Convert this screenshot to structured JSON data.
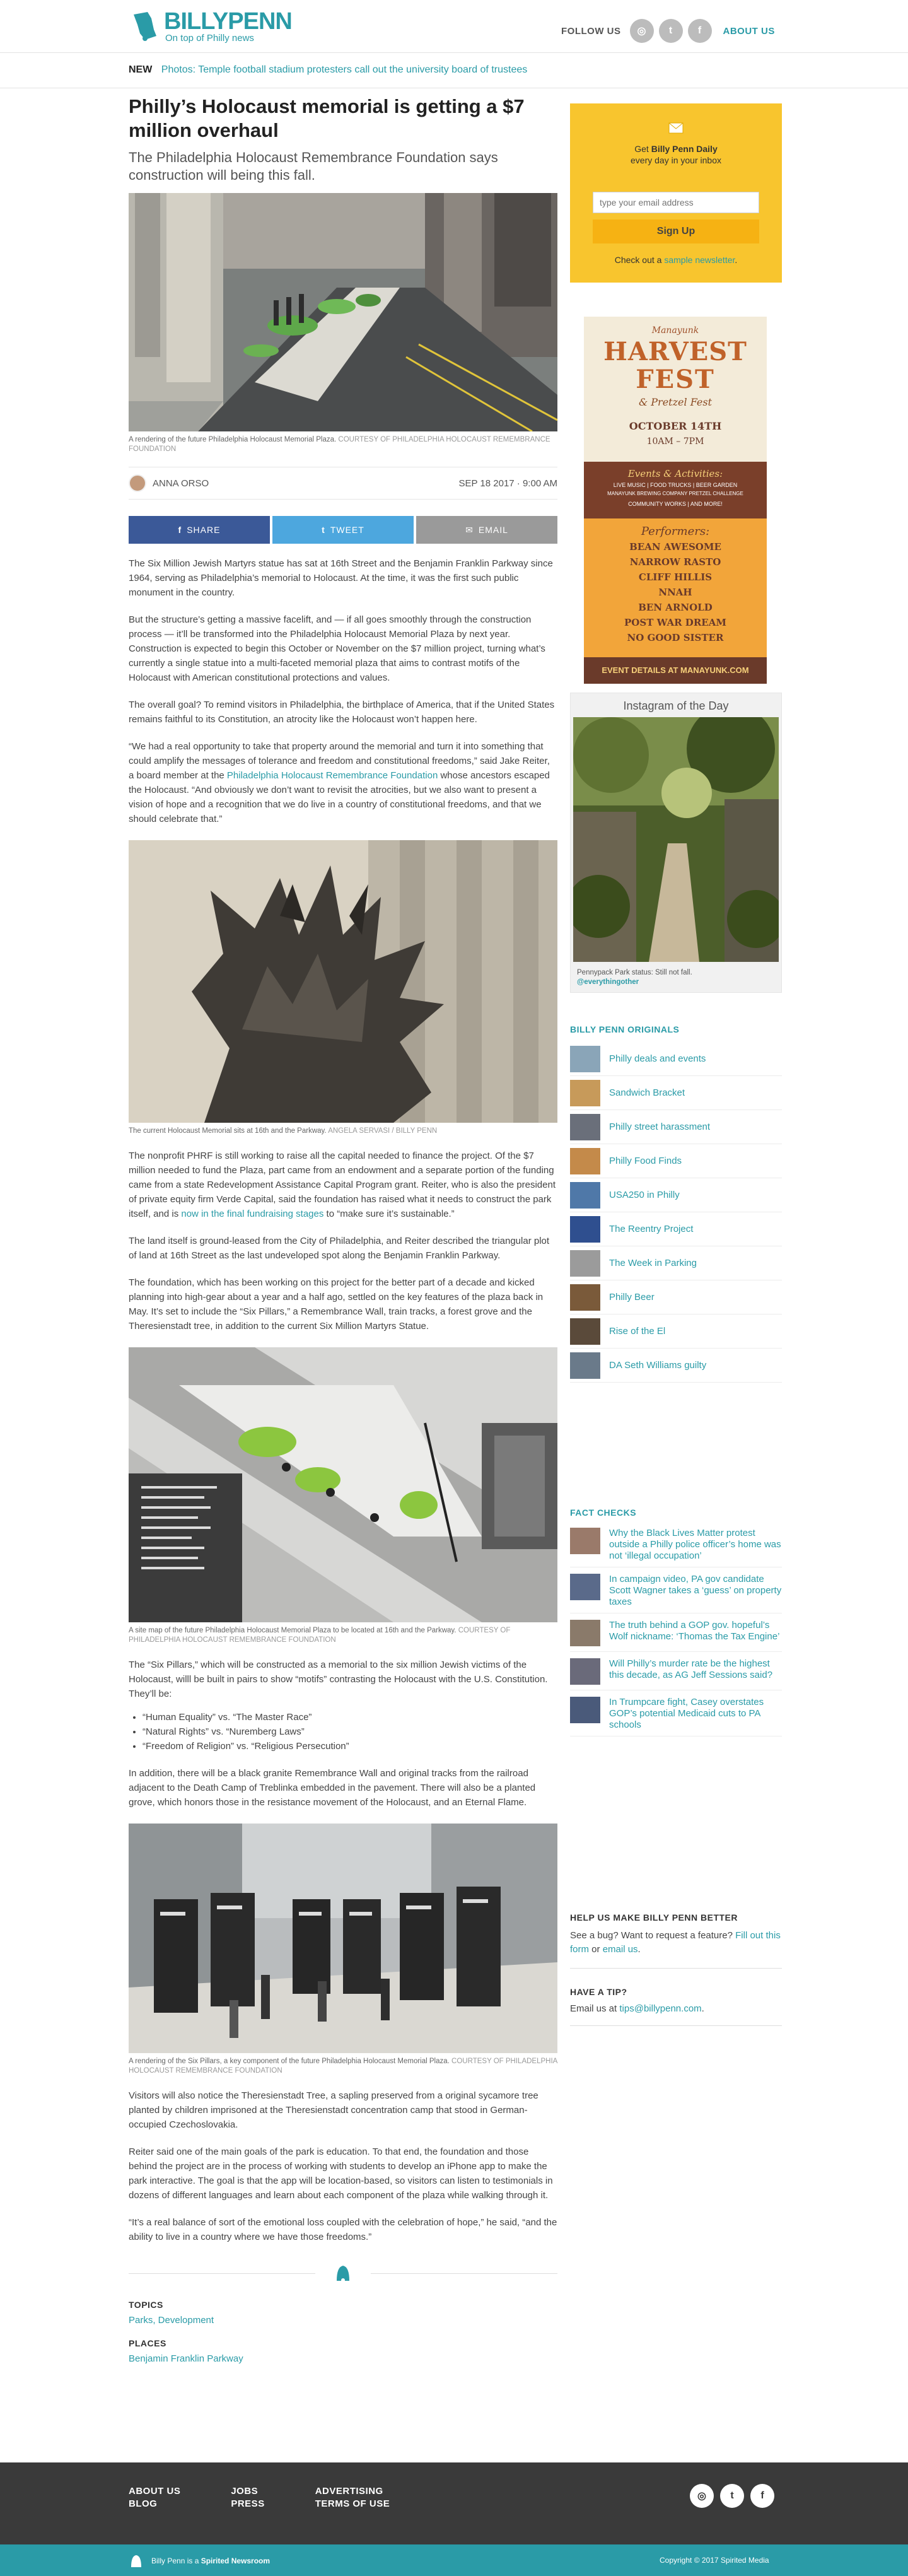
{
  "header": {
    "logo_title": "BILLYPENN",
    "logo_tagline": "On top of Philly news",
    "follow_label": "FOLLOW US",
    "about_label": "ABOUT US"
  },
  "news_bar": {
    "label": "NEW",
    "headline": "Photos: Temple football stadium protesters call out the university board of trustees"
  },
  "article": {
    "title": "Philly’s Holocaust memorial is getting a $7 million overhaul",
    "subtitle": "The Philadelphia Holocaust Remembrance Foundation says construction will being this fall.",
    "hero_caption": "A rendering of the future Philadelphia Holocaust Memorial Plaza.",
    "hero_credit": "COURTESY OF PHILADELPHIA HOLOCAUST REMEMBRANCE FOUNDATION",
    "author": "ANNA ORSO",
    "date": "SEP 18 2017 · 9:00 AM",
    "share": {
      "facebook": "SHARE",
      "twitter": "TWEET",
      "email": "EMAIL"
    },
    "p1": "The Six Million Jewish Martyrs statue has sat at 16th Street and the Benjamin Franklin Parkway since 1964, serving as Philadelphia’s memorial to Holocaust. At the time, it was the first such public monument in the country.",
    "p2": "But the structure’s getting a massive facelift, and — if all goes smoothly through the construction process — it’ll be transformed into the Philadelphia Holocaust Memorial Plaza by next year. Construction is expected to begin this October or November on the $7 million project, turning what’s currently a single statue into a multi-faceted memorial plaza that aims to contrast motifs of the Holocaust with American constitutional protections and values.",
    "p3": "The overall goal? To remind visitors in Philadelphia, the birthplace of America, that if the United States remains faithful to its Constitution, an atrocity like the Holocaust won’t happen here.",
    "p4a": "“We had a real opportunity to take that property around the memorial and turn it into something that could amplify the messages of tolerance and freedom and constitutional freedoms,” said Jake Reiter, a board member at the ",
    "p4_link": "Philadelphia Holocaust Remembrance Foundation",
    "p4b": " whose ancestors escaped the Holocaust. “And obviously we don’t want to revisit the atrocities, but we also want to present a vision of hope and a recognition that we do live in a country of constitutional freedoms, and that we should celebrate that.”",
    "statue_caption": "The current Holocaust Memorial sits at 16th and the Parkway.",
    "statue_credit": "ANGELA SERVASI / BILLY PENN",
    "p5a": "The nonprofit PHRF is still working to raise all the capital needed to finance the project. Of the $7 million needed to fund the Plaza, part came from an endowment and a separate portion of the funding came from a state Redevelopment Assistance Capital Program grant. Reiter, who is also the president of private equity firm Verde Capital, said the foundation has raised what it needs to construct the park itself, and is ",
    "p5_link": "now in the final fundraising stages",
    "p5b": " to “make sure it’s sustainable.”",
    "p6": "The land itself is ground-leased from the City of Philadelphia, and Reiter described the triangular plot of land at 16th Street as the last undeveloped spot along the Benjamin Franklin Parkway.",
    "p7": "The foundation, which has been working on this project for the better part of a decade and kicked planning into high-gear about a year and a half ago, settled on the key features of the plaza back in May. It’s set to include the “Six Pillars,” a Remembrance Wall, train tracks, a forest grove and the Theresienstadt tree, in addition to the current Six Million Martyrs Statue.",
    "map_caption": "A site map of the future Philadelphia Holocaust Memorial Plaza to be located at 16th and the Parkway.",
    "map_credit": "COURTESY OF PHILADELPHIA HOLOCAUST REMEMBRANCE FOUNDATION",
    "p8": "The “Six Pillars,” which will be constructed as a memorial to the six million Jewish victims of the Holocaust, willl be built in pairs to show “motifs” contrasting the Holocaust with the U.S. Constitution. They’ll be:",
    "bullets": [
      "“Human Equality” vs. “The Master Race”",
      "“Natural Rights” vs. “Nuremberg Laws”",
      "“Freedom of Religion” vs. “Religious Persecution”"
    ],
    "p9": "In addition, there will be a black granite Remembrance Wall and original tracks from the railroad adjacent to the Death Camp of Treblinka embedded in the pavement. There will also be a planted grove, which honors those in the resistance movement of the Holocaust, and an Eternal Flame.",
    "pillars_caption": "A rendering of the Six Pillars, a key component of the future Philadelphia Holocaust Memorial Plaza.",
    "pillars_credit": "COURTESY OF PHILADELPHIA HOLOCAUST REMEMBRANCE FOUNDATION",
    "p10": "Visitors will also notice the Theresienstadt Tree, a sapling preserved from a original sycamore tree planted by children imprisoned at the Theresienstadt concentration camp that stood in German-occupied Czechoslovakia.",
    "p11": "Reiter said one of the main goals of the park is education. To that end, the foundation and those behind the project are in the process of working with students to develop an iPhone app to make the park interactive. The goal is that the app will be location-based, so visitors can listen to testimonials in dozens of different languages and learn about each component of the plaza while walking through it.",
    "p12": "“It’s a real balance of sort of the emotional loss coupled with the celebration of hope,” he said, “and the ability to live in a country where we have those freedoms.”"
  },
  "topics": {
    "topics_label": "TOPICS",
    "topics_value": "Parks, Development",
    "places_label": "PLACES",
    "places_value": "Benjamin Franklin Parkway"
  },
  "newsletter": {
    "line1_a": "Get ",
    "line1_b": "Billy Penn Daily",
    "line2": "every day in your inbox",
    "placeholder": "type your email address",
    "button": "Sign Up",
    "sample_a": "Check out a ",
    "sample_link": "sample newsletter",
    "sample_b": "."
  },
  "ad": {
    "small": "Manayunk",
    "title1": "HARVEST",
    "title2": "FEST",
    "subtitle": "& Pretzel Fest",
    "date": "OCTOBER 14TH",
    "time": "10AM – 7PM",
    "events_title": "Events & Activities:",
    "events_1": "LIVE MUSIC | FOOD TRUCKS | BEER GARDEN",
    "events_2": "MANAYUNK BREWING COMPANY PRETZEL CHALLENGE",
    "events_3": "COMMUNITY WORKS | AND MORE!",
    "performers_title": "Performers:",
    "performers": [
      "BEAN AWESOME",
      "NARROW RASTO",
      "CLIFF HILLIS",
      "NNAH",
      "BEN ARNOLD",
      "POST WAR DREAM",
      "NO GOOD SISTER"
    ],
    "footer": "EVENT DETAILS AT MANAYUNK.COM"
  },
  "instagram": {
    "title": "Instagram of the Day",
    "caption": "Pennypack Park status: Still not fall.",
    "handle": "@everythingother"
  },
  "originals": {
    "title": "BILLY PENN ORIGINALS",
    "items": [
      "Philly deals and events",
      "Sandwich Bracket",
      "Philly street harassment",
      "Philly Food Finds",
      "USA250 in Philly",
      "The Reentry Project",
      "The Week in Parking",
      "Philly Beer",
      "Rise of the El",
      "DA Seth Williams guilty"
    ]
  },
  "fact_checks": {
    "title": "FACT CHECKS",
    "items": [
      "Why the Black Lives Matter protest outside a Philly police officer’s home was not ‘illegal occupation’",
      "In campaign video, PA gov candidate Scott Wagner takes a ‘guess’ on property taxes",
      "The truth behind a GOP gov. hopeful’s Wolf nickname: ‘Thomas the Tax Engine’",
      "Will Philly’s murder rate be the highest this decade, as AG Jeff Sessions said?",
      "In Trumpcare fight, Casey overstates GOP’s potential Medicaid cuts to PA schools"
    ]
  },
  "help": {
    "title": "HELP US MAKE BILLY PENN BETTER",
    "text_a": "See a bug? Want to request a feature? ",
    "link_a": "Fill out this form",
    "text_b": " or ",
    "link_b": "email us",
    "text_c": "."
  },
  "tip": {
    "title": "HAVE A TIP?",
    "text": "Email us at ",
    "link": "tips@billypenn.com",
    "text_b": "."
  },
  "footer": {
    "links_col1": [
      "ABOUT US",
      "BLOG"
    ],
    "links_col2": [
      "JOBS",
      "PRESS"
    ],
    "links_col3": [
      "ADVERTISING",
      "TERMS OF USE"
    ],
    "spirited_a": "Billy Penn is a ",
    "spirited_b": "Spirited Newsroom",
    "copyright": "Copyright © 2017 Spirited Media"
  },
  "colors": {
    "brand": "#2a9ba7",
    "newsletter_bg": "#f8c52e",
    "facebook": "#3b5998",
    "twitter": "#4da7de",
    "footer_bg": "#3a3a3a"
  }
}
